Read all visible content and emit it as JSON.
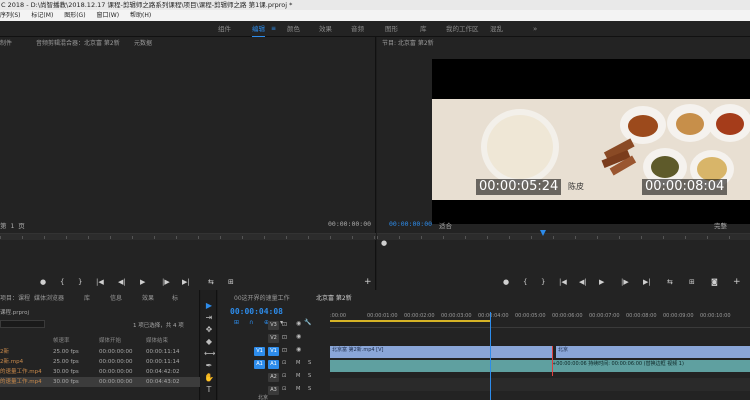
{
  "window": {
    "title": "C 2018 - D:\\尚智播教\\2018.12.17 课程-剪辑师之路系列课程\\项目\\课程-剪辑师之路 第1课.prproj *"
  },
  "menu": [
    "序列(S)",
    "标记(M)",
    "图形(G)",
    "窗口(W)",
    "帮助(H)"
  ],
  "workspaces": {
    "items": [
      "组件",
      "编辑",
      "颜色",
      "效果",
      "音频",
      "图形",
      "库",
      "我的工作区",
      "混乱"
    ],
    "active": "编辑",
    "menu_glyph": "≡",
    "more": "»"
  },
  "source_panel": {
    "tabs": [
      "制件",
      "音频剪辑混合器：北京富 第2新",
      "元数据"
    ],
    "fit_label": "第 1 页",
    "timecode_right": "00:00:00:00"
  },
  "program_panel": {
    "title": "节目: 北京富 第2新",
    "timecode_left": "00:00:00:00",
    "fit_label": "适合",
    "quality_label": "完整",
    "overlay_tc_left": "00:00:05:24",
    "overlay_tc_right": "00:00:08:04",
    "frame_caption": "陈皮"
  },
  "transport_icons": [
    "marker-icon",
    "mark-in-icon",
    "mark-out-icon",
    "go-to-in-icon",
    "step-back-icon",
    "play-icon",
    "step-forward-icon",
    "go-to-out-icon",
    "insert-icon",
    "overwrite-icon",
    "export-frame-icon"
  ],
  "transport_glyphs": [
    "●",
    "{",
    "}",
    "|◀",
    "◀|",
    "▶",
    "|▶",
    "▶|",
    "⇆",
    "⊞",
    "◙"
  ],
  "add_glyph": "+",
  "project_panel": {
    "tabs": [
      "项目：课程",
      "媒体浏览器",
      "库",
      "信息",
      "效果",
      "标"
    ],
    "breadcrumb": "课程.prproj",
    "selection_info": "1 项已选择，共 4 项",
    "columns": [
      "帧速率",
      "媒体开始",
      "媒体结束"
    ],
    "rows": [
      {
        "name": "2新",
        "fps": "25.00 fps",
        "start": "00:00:00:00",
        "end": "00:00:11:14"
      },
      {
        "name": "2新.mp4",
        "fps": "25.00 fps",
        "start": "00:00:00:00",
        "end": "00:00:11:14"
      },
      {
        "name": "的速量工作.mp4",
        "fps": "30.00 fps",
        "start": "00:00:00:00",
        "end": "00:04:42:02"
      },
      {
        "name": "的速量工作.mp4",
        "fps": "30.00 fps",
        "start": "00:00:00:00",
        "end": "00:04:43:02"
      }
    ]
  },
  "tools": [
    "▶",
    "⇥",
    "✥",
    "◆",
    "⟷",
    "✒",
    "✋",
    "T"
  ],
  "timeline": {
    "tabs": [
      "00这开界的速量工作",
      "北京富 第2新"
    ],
    "timecode": "00:00:04:08",
    "ruler": [
      ":00:00",
      "00:00:01:00",
      "00:00:02:00",
      "00:00:03:00",
      "00:00:04:00",
      "00:00:05:00",
      "00:00:06:00",
      "00:00:07:00",
      "00:00:08:00",
      "00:00:09:00",
      "00:00:10:00"
    ],
    "tracks": [
      "V3",
      "V2",
      "V1",
      "A1",
      "A2",
      "A3"
    ],
    "track_source": [
      "",
      "",
      "V1",
      "A1",
      "",
      ""
    ],
    "clip_video": "北京富 第2新.mp4 [V]",
    "clip_audio_label": "+00:00:00:06 持续时间: 00:00:06:00 (替换边框 视频 1)",
    "clip_mini": "北京",
    "track_toggle_labels": [
      "M",
      "S"
    ],
    "snap_glyph": "∩",
    "link_glyph": "⊕",
    "marker_glyph": "▾",
    "settings_glyph": "🔧",
    "scroll_label": "北京"
  },
  "colors": {
    "accent": "#2d8ceb",
    "video_clip": "#8aa6d8",
    "audio_clip": "#5fa0a0"
  }
}
